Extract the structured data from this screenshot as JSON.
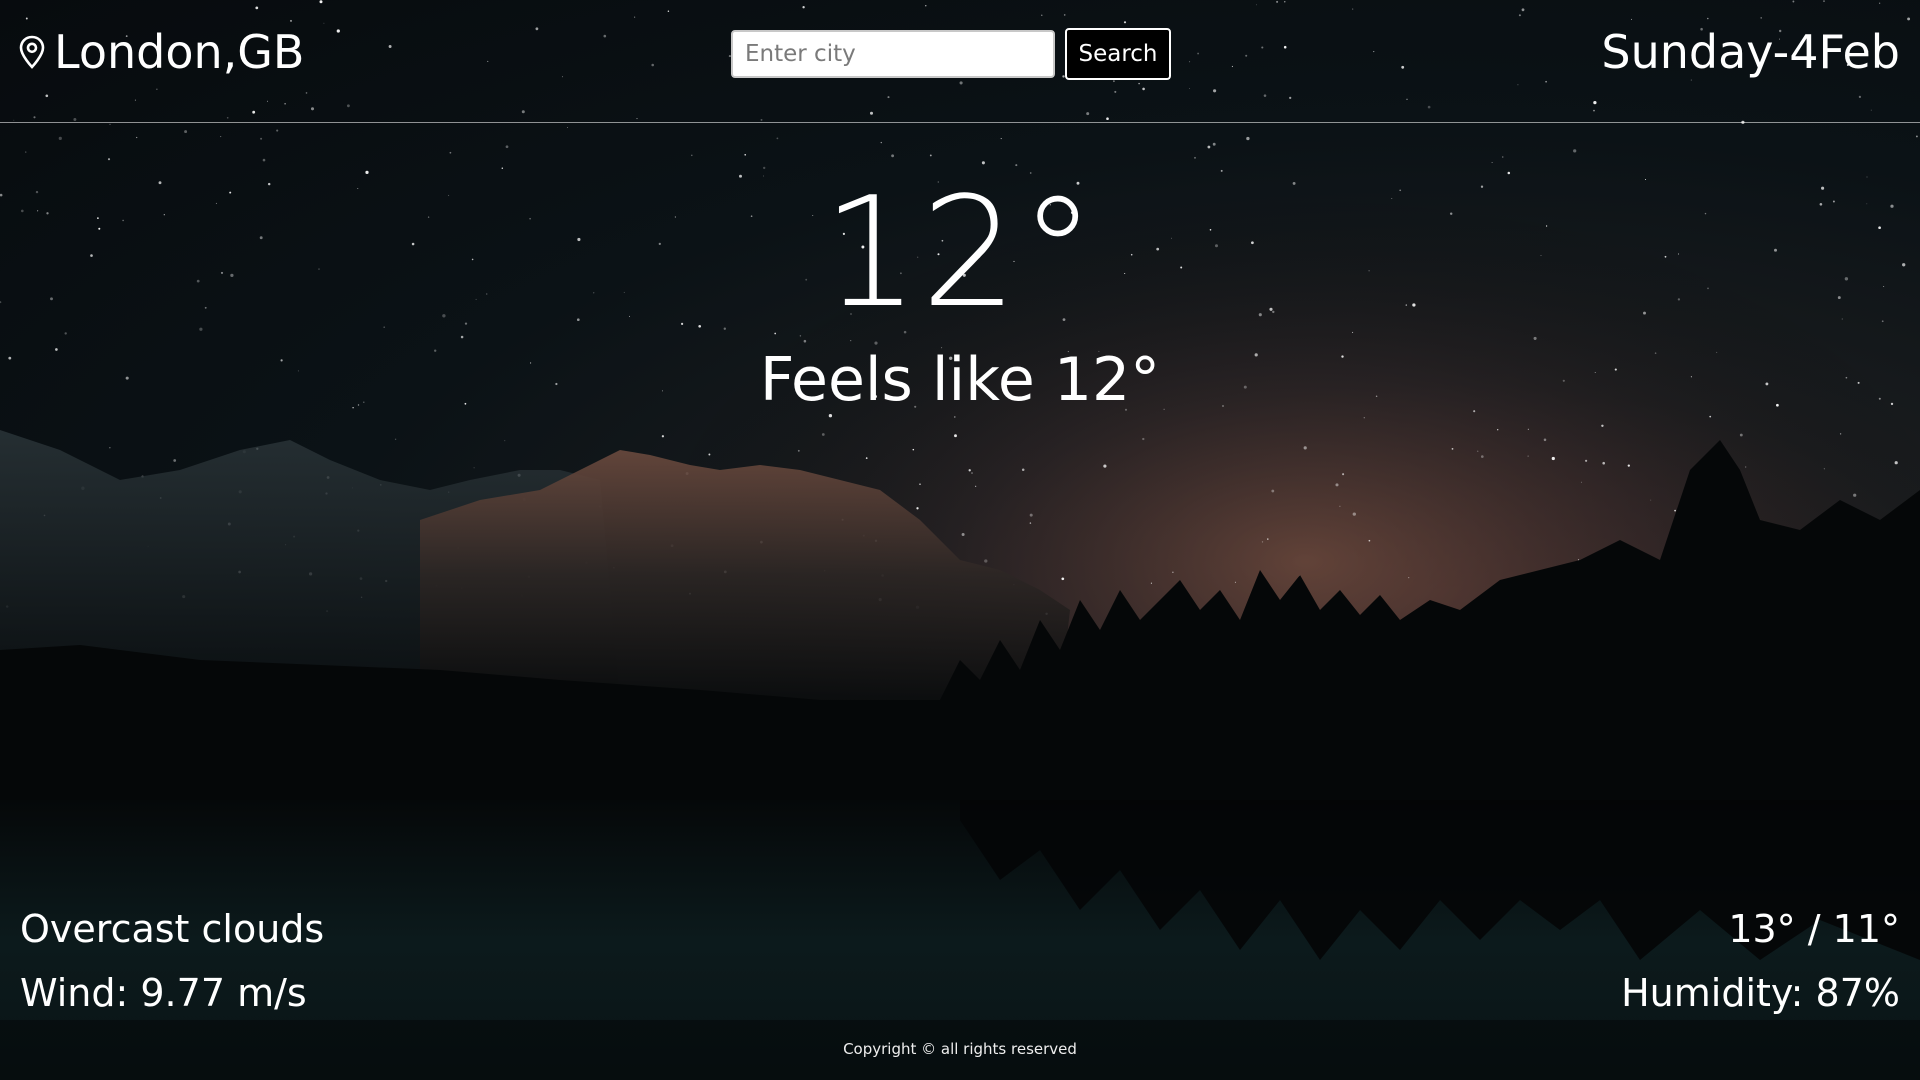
{
  "location": {
    "icon": "map-pin-icon",
    "text": "London,GB"
  },
  "search": {
    "placeholder": "Enter city",
    "value": "",
    "button_label": "Search"
  },
  "date": "Sunday-4Feb",
  "weather": {
    "temperature": "12°",
    "feels_like": "Feels like 12°",
    "description": "Overcast clouds",
    "wind": "Wind: 9.77 m/s",
    "min_max": "13° / 11°",
    "humidity": "Humidity: 87%"
  },
  "footer": {
    "copyright": "Copyright © all rights reserved"
  },
  "colors": {
    "text": "#ffffff",
    "button_bg": "#000000",
    "input_bg": "#ffffff"
  }
}
